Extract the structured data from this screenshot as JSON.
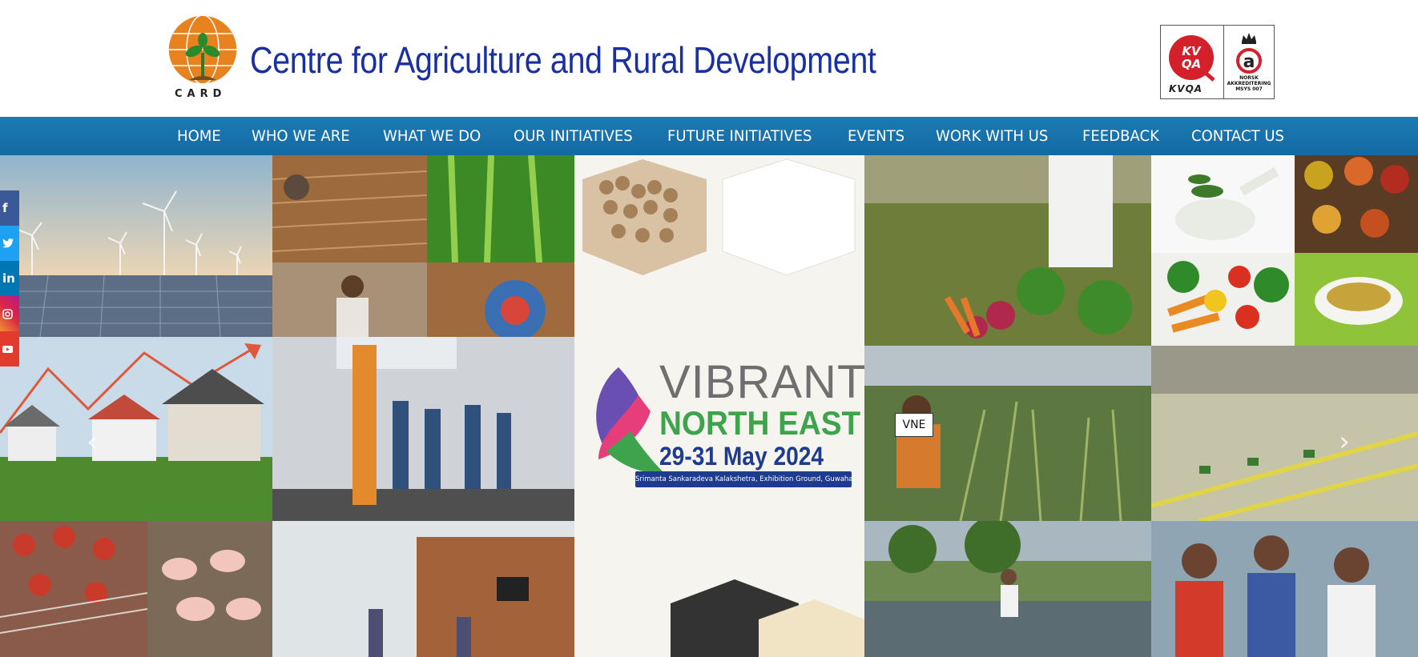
{
  "header": {
    "logo_text": "CARD",
    "title": "Centre for Agriculture and Rural Development",
    "cert": {
      "kvqa_label": "KVQA",
      "norsk_line1": "NORSK",
      "norsk_line2": "AKKREDITERING",
      "norsk_line3": "MSYS 007"
    }
  },
  "nav": {
    "items": [
      {
        "label": "HOME"
      },
      {
        "label": "WHO WE ARE"
      },
      {
        "label": "WHAT WE DO"
      },
      {
        "label": "OUR INITIATIVES"
      },
      {
        "label": "FUTURE INITIATIVES"
      },
      {
        "label": "EVENTS"
      },
      {
        "label": "WORK WITH US"
      },
      {
        "label": "FEEDBACK"
      },
      {
        "label": "CONTACT US"
      }
    ],
    "bg_color": "#1a74ae"
  },
  "hero": {
    "event_line1": "VIBRANT",
    "event_line2": "NORTH EAST",
    "event_dates": "29-31 May 2024",
    "event_venue": "Srimanta Sankaradeva Kalakshetra, Exhibition Ground, Guwahati",
    "caption": "VNE",
    "prev_icon": "chevron-left-icon",
    "next_icon": "chevron-right-icon"
  },
  "social": [
    {
      "icon": "facebook-icon",
      "glyph": "f",
      "color": "#3b5998"
    },
    {
      "icon": "twitter-icon",
      "glyph": "t",
      "color": "#1da1f2"
    },
    {
      "icon": "linkedin-icon",
      "glyph": "in",
      "color": "#0077b5"
    },
    {
      "icon": "instagram-icon",
      "glyph": "◎",
      "color": "#c13584"
    },
    {
      "icon": "youtube-icon",
      "glyph": "▶",
      "color": "#e23b2e"
    }
  ],
  "colors": {
    "title_blue": "#1a2fa0",
    "logo_orange": "#e8821e",
    "vne_green": "#3fa34d",
    "vne_navy": "#1e3b8f"
  }
}
